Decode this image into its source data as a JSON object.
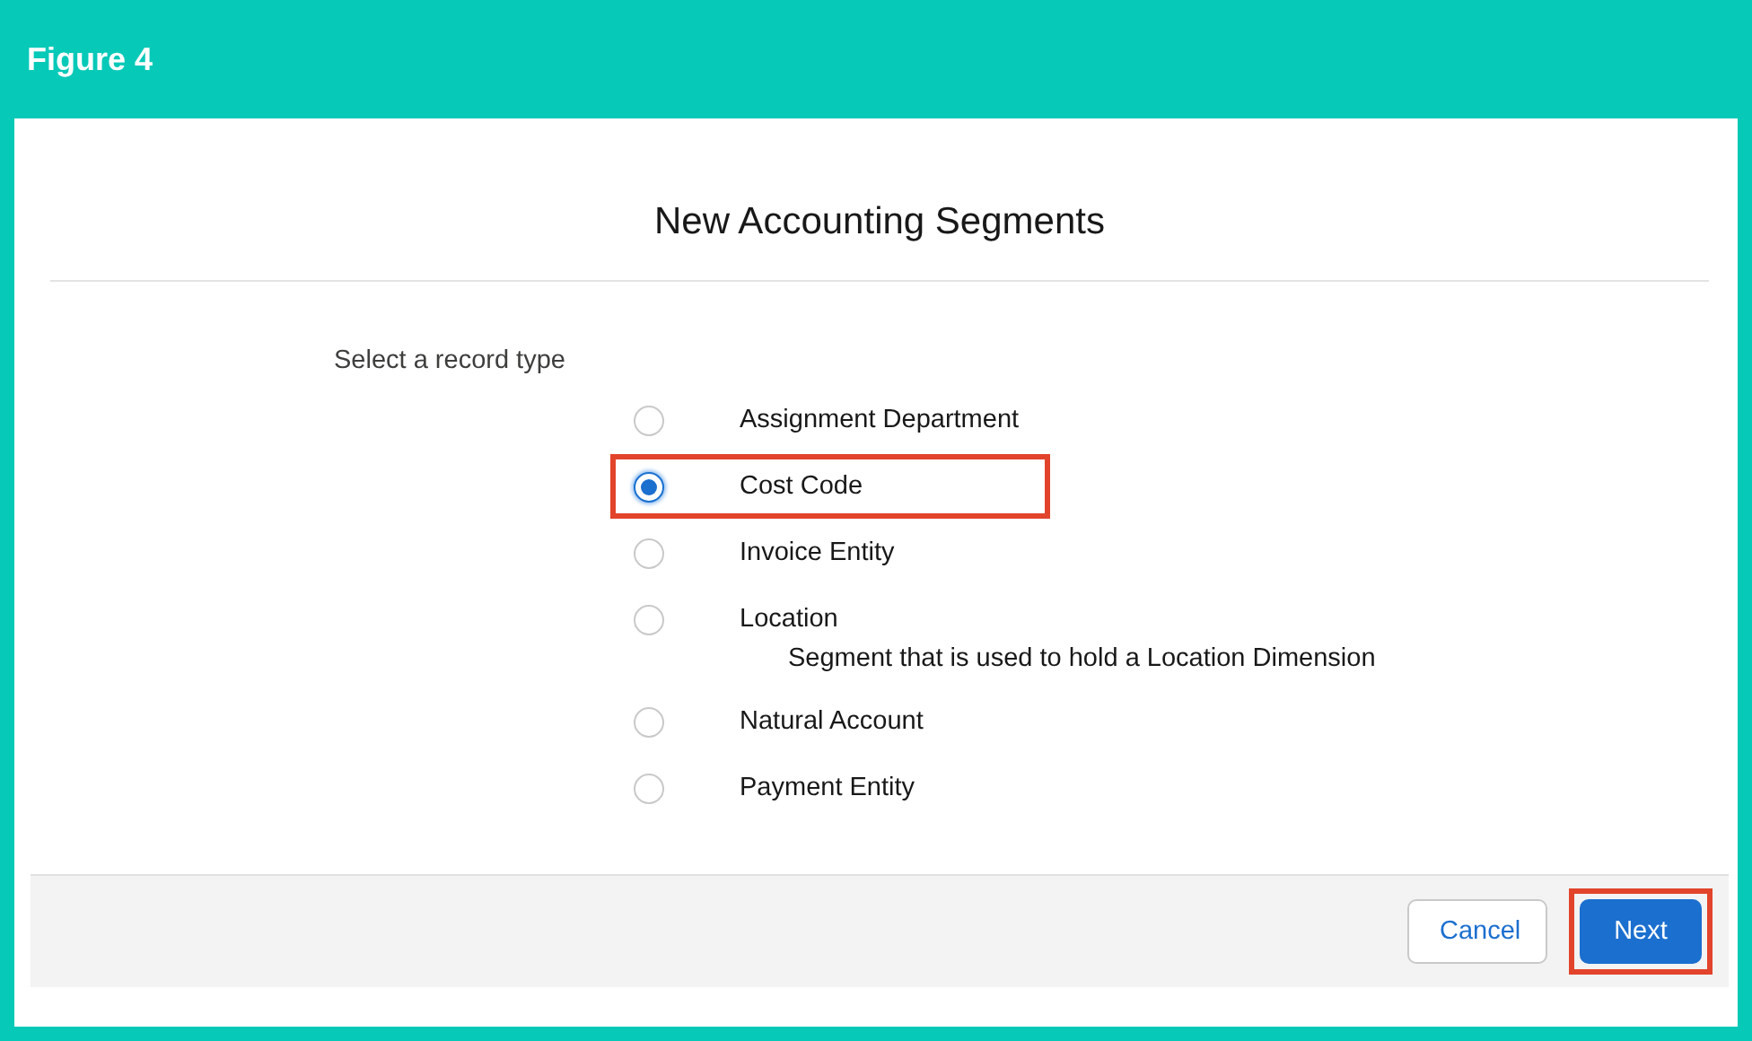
{
  "figure_label": "Figure 4",
  "dialog": {
    "title": "New Accounting Segments",
    "prompt": "Select a record type",
    "options": [
      {
        "label": "Assignment Department",
        "selected": false,
        "highlighted": false
      },
      {
        "label": "Cost Code",
        "selected": true,
        "highlighted": true
      },
      {
        "label": "Invoice Entity",
        "selected": false,
        "highlighted": false
      },
      {
        "label": "Location",
        "selected": false,
        "highlighted": false,
        "description": "Segment that is used to hold a Location Dimension"
      },
      {
        "label": "Natural Account",
        "selected": false,
        "highlighted": false
      },
      {
        "label": "Payment Entity",
        "selected": false,
        "highlighted": false
      }
    ],
    "buttons": [
      {
        "label": "Cancel",
        "kind": "neutral",
        "highlighted": false
      },
      {
        "label": "Next",
        "kind": "brand",
        "highlighted": true
      }
    ]
  }
}
